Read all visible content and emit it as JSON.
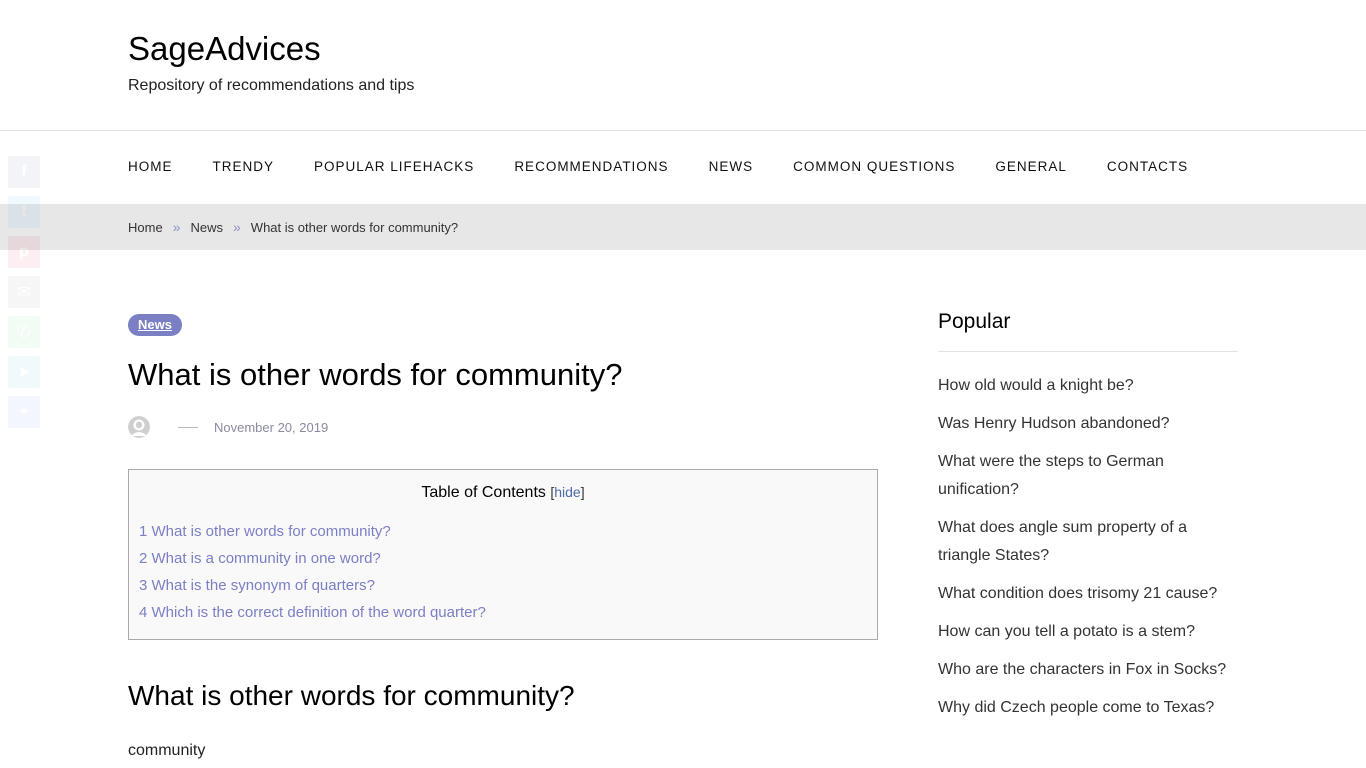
{
  "site": {
    "title": "SageAdvices",
    "description": "Repository of recommendations and tips"
  },
  "nav": {
    "items": [
      {
        "label": "HOME"
      },
      {
        "label": "TRENDY"
      },
      {
        "label": "POPULAR LIFEHACKS"
      },
      {
        "label": "RECOMMENDATIONS"
      },
      {
        "label": "NEWS"
      },
      {
        "label": "COMMON QUESTIONS"
      },
      {
        "label": "GENERAL"
      },
      {
        "label": "CONTACTS"
      }
    ]
  },
  "breadcrumb": {
    "items": [
      "Home",
      "News",
      "What is other words for community?"
    ],
    "separator": "»"
  },
  "share": {
    "buttons": [
      {
        "icon": "facebook-icon",
        "glyph": "f",
        "color": "#3b5998"
      },
      {
        "icon": "twitter-icon",
        "glyph": "t",
        "color": "#1da1f2"
      },
      {
        "icon": "pinterest-icon",
        "glyph": "p",
        "color": "#e60023"
      },
      {
        "icon": "email-icon",
        "glyph": "✉",
        "color": "#777777"
      },
      {
        "icon": "whatsapp-icon",
        "glyph": "✆",
        "color": "#25d366"
      },
      {
        "icon": "telegram-icon",
        "glyph": "➤",
        "color": "#2ca5e0"
      },
      {
        "icon": "share-icon",
        "glyph": "+",
        "color": "#4a7bd0"
      }
    ]
  },
  "post": {
    "category": "News",
    "title": "What is other words for community?",
    "date": "November 20, 2019",
    "dash": "—"
  },
  "toc": {
    "title": "Table of Contents",
    "toggle_label": "hide",
    "items": [
      "1 What is other words for community?",
      "2 What is a community in one word?",
      "3 What is the synonym of quarters?",
      "4 Which is the correct definition of the word quarter?"
    ]
  },
  "content": {
    "section_title": "What is other words for community?",
    "paragraph_start": "community"
  },
  "sidebar": {
    "title": "Popular",
    "items": [
      "How old would a knight be?",
      "Was Henry Hudson abandoned?",
      "What were the steps to German unification?",
      "What does angle sum property of a triangle States?",
      "What condition does trisomy 21 cause?",
      "How can you tell a potato is a stem?",
      "Who are the characters in Fox in Socks?",
      "Why did Czech people come to Texas?"
    ]
  },
  "colors": {
    "accent": "#7b7fc4",
    "breadcrumb_bg": "#e7e7e7",
    "toc_link": "#7b7fc4"
  }
}
